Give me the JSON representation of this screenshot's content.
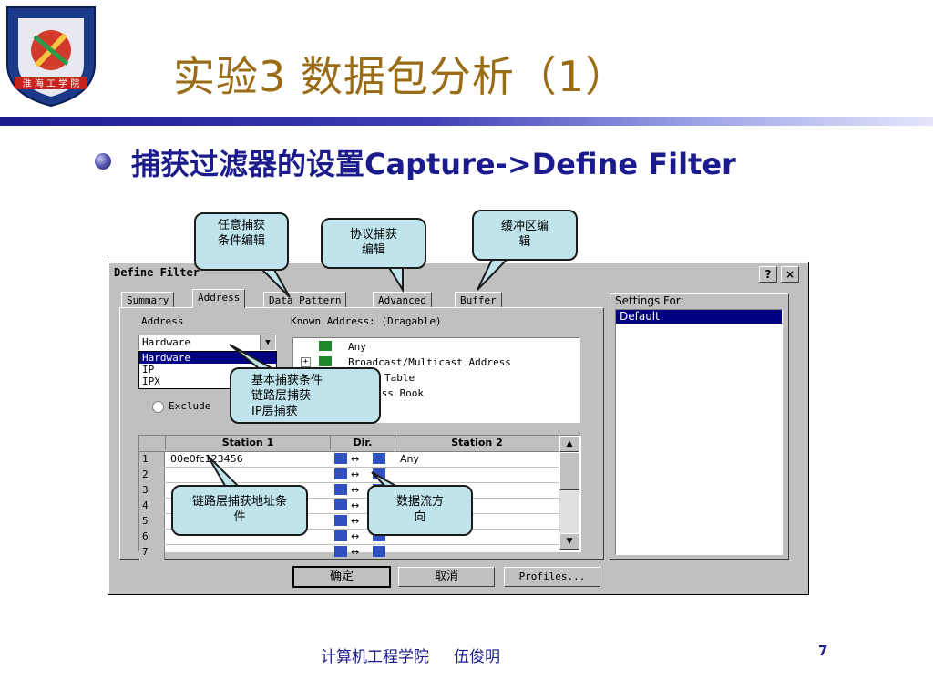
{
  "slide": {
    "title": "实验3  数据包分析（1）",
    "bullet": "捕获过滤器的设置Capture->Define Filter",
    "footer": "计算机工程学院     伍俊明",
    "page_number": "7"
  },
  "logo": {
    "icon": "university-seal-icon",
    "label": "HUAIHAI INSTITUTE OF TECHNOLOGY"
  },
  "dialog": {
    "title": "Define Filter",
    "help_button": "?",
    "close_button": "×",
    "tabs": [
      "Summary",
      "Address",
      "Data Pattern",
      "Advanced",
      "Buffer"
    ],
    "active_tab": "Address",
    "address": {
      "label": "Address",
      "combo_value": "Hardware",
      "dropdown_options": [
        "Hardware",
        "IP",
        "IPX"
      ],
      "exclude_label": "Exclude",
      "known_address_label": "Known Address: (Dragable)",
      "known_items": [
        "Any",
        "Broadcast/Multicast Address",
        "Table",
        "ess Book"
      ]
    },
    "grid": {
      "headers": [
        "Station 1",
        "Dir.",
        "Station 2"
      ],
      "rows": [
        {
          "num": "1",
          "station1": "00e0fc123456",
          "station2": "Any"
        },
        {
          "num": "2",
          "station1": "",
          "station2": ""
        },
        {
          "num": "3",
          "station1": "",
          "station2": ""
        },
        {
          "num": "4",
          "station1": "",
          "station2": ""
        },
        {
          "num": "5",
          "station1": "",
          "station2": ""
        },
        {
          "num": "6",
          "station1": "",
          "station2": ""
        },
        {
          "num": "7",
          "station1": "",
          "station2": ""
        }
      ],
      "direction_symbol": "↔"
    },
    "settings_for_label": "Settings For:",
    "settings_items": [
      "Default"
    ],
    "buttons": {
      "ok": "确定",
      "cancel": "取消",
      "profiles": "Profiles..."
    }
  },
  "callouts": {
    "any_capture": "任意捕获条件编辑",
    "protocol": "协议捕获编辑",
    "buffer": "缓冲区编辑",
    "basic": [
      "基本捕获条件",
      "链路层捕获",
      "IP层捕获"
    ],
    "link_address": "链路层捕获地址条件",
    "data_flow": "数据流方向"
  },
  "colors": {
    "title": "#9a6c16",
    "text_blue": "#1b1b8e",
    "callout_fill": "#bfe4ec",
    "selection": "#000080"
  }
}
